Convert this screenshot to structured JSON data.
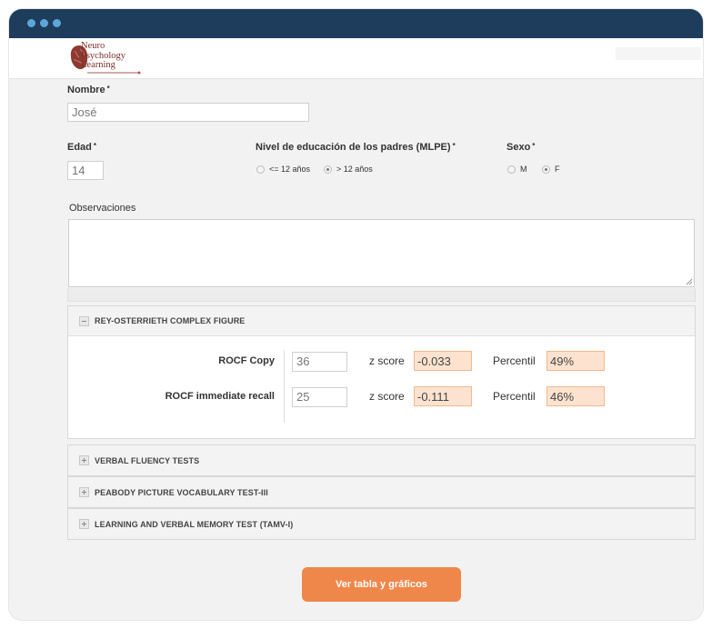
{
  "colors": {
    "titlebar": "#1e3d5c",
    "accent": "#f0874a",
    "score_bg": "#fde3cf"
  },
  "logo": {
    "line1": "Neuro",
    "line2": "Psychology",
    "line3": "Learning",
    "icon": "brain-icon"
  },
  "form": {
    "nombre": {
      "label": "Nombre",
      "required": "*",
      "value": "José"
    },
    "edad": {
      "label": "Edad",
      "required": "*",
      "value": "14"
    },
    "mlpe": {
      "label": "Nivel de educación de los padres (MLPE)",
      "required": "*",
      "options": [
        {
          "label": "<= 12 años",
          "checked": false
        },
        {
          "label": "> 12 años",
          "checked": true
        }
      ]
    },
    "sexo": {
      "label": "Sexo",
      "required": "*",
      "options": [
        {
          "label": "M",
          "checked": false
        },
        {
          "label": "F",
          "checked": true
        }
      ]
    },
    "observaciones": {
      "label": "Observaciones",
      "value": ""
    }
  },
  "sections": {
    "rocf": {
      "title": "REY-OSTERRIETH COMPLEX FIGURE",
      "rows": [
        {
          "label": "ROCF Copy",
          "value": "36",
          "z_label": "z score",
          "z": "-0.033",
          "p_label": "Percentil",
          "p": "49%"
        },
        {
          "label": "ROCF immediate recall",
          "value": "25",
          "z_label": "z score",
          "z": "-0.111",
          "p_label": "Percentil",
          "p": "46%"
        }
      ]
    },
    "verbal": {
      "title": "VERBAL FLUENCY TESTS"
    },
    "peabody": {
      "title": "PEABODY PICTURE VOCABULARY TEST-III"
    },
    "tamv": {
      "title": "LEARNING AND VERBAL MEMORY TEST (TAMV-I)"
    }
  },
  "cta": {
    "label": "Ver tabla y gráficos"
  }
}
